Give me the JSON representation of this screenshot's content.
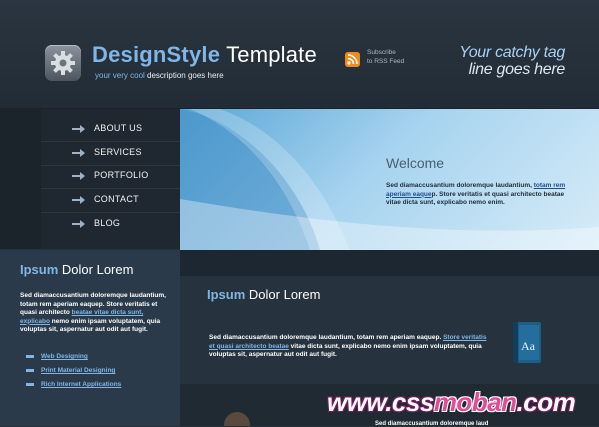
{
  "header": {
    "brand_bold": "DesignStyle",
    "brand_rest": "Template",
    "tagline_colored": "your very cool",
    "tagline_rest": "description goes here",
    "rss_line1": "Subscribe",
    "rss_line2": "to RSS Feed",
    "catchy_line1": "Your catchy tag",
    "catchy_line2": "line goes here"
  },
  "nav": {
    "items": [
      {
        "label": "ABOUT US"
      },
      {
        "label": "SERVICES"
      },
      {
        "label": "PORTFOLIO"
      },
      {
        "label": "CONTACT"
      },
      {
        "label": "BLOG"
      }
    ]
  },
  "hero": {
    "title": "Welcome",
    "text_before": "Sed diamaccusantium doloremque laudantium,",
    "link": "totam rem aperiam eaque",
    "text_after": "p. Store veritatis et quasi architecto beatae vitae dicta sunt, explicabo nemo enim."
  },
  "sidebar": {
    "title_colored": "Ipsum",
    "title_rest": "Dolor Lorem",
    "text_before": "Sed diamaccusantium doloremque laudantium, totam rem aperiam eaquep. Store veritatis et quasi architecto",
    "link": "beatae vitae dicta sunt, explicabo",
    "text_after": "nemo enim ipsam voluptatem, quia voluptas sit, aspernatur aut odit aut fugit.",
    "links": [
      {
        "label": "Web Designing"
      },
      {
        "label": "Print Material Designing"
      },
      {
        "label": "Rich Internet Applications"
      }
    ]
  },
  "main": {
    "title_colored": "Ipsum",
    "title_rest": "Dolor Lorem",
    "text_before": "Sed diamaccusantium doloremque laudantium, totam rem aperiam eaquep.",
    "link": "Store veritatis et quasi architecto beatae",
    "text_after": "vitae dicta sunt, explicabo nemo enim ipsam voluptatem, quia voluptas sit, aspernatur aut odit aut fugit.",
    "book_label": "Aa",
    "bottom_text": "Sed diamaccusantium doloremque laud"
  },
  "watermark": {
    "part1": "www.css",
    "part2": "moban",
    "part3": ".com"
  },
  "colors": {
    "accent": "#7fb6e6",
    "background": "#26313c",
    "rss": "#f08a1d"
  }
}
